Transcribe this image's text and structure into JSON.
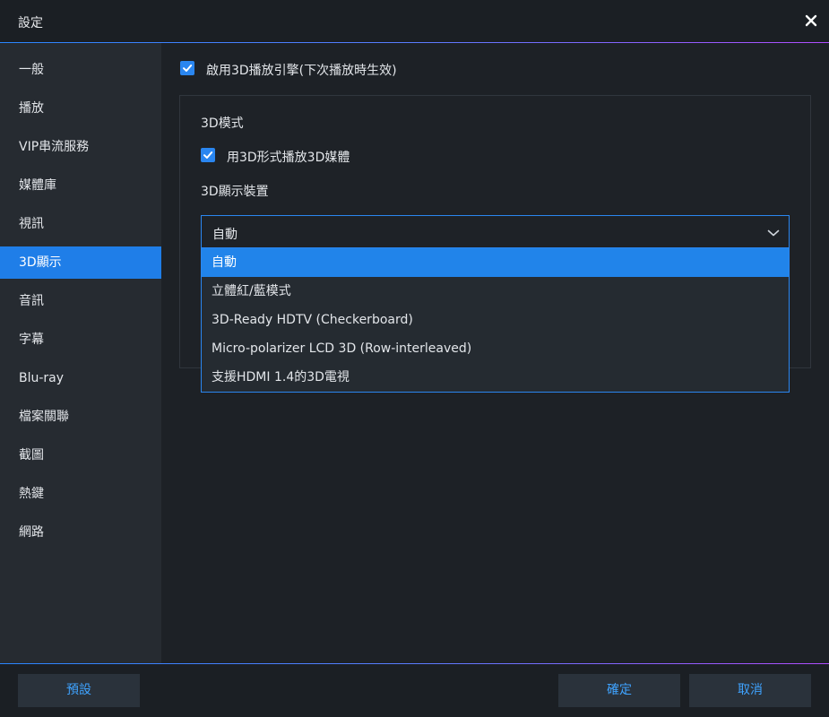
{
  "window": {
    "title": "設定",
    "close_icon": "close-icon"
  },
  "colors": {
    "accent": "#1f7ee8",
    "checkbox": "#2a86f0",
    "button_text": "#3fa3ff",
    "gradient_end": "#b14dff"
  },
  "sidebar": {
    "items": [
      {
        "label": "一般"
      },
      {
        "label": "播放"
      },
      {
        "label": "VIP串流服務"
      },
      {
        "label": "媒體庫"
      },
      {
        "label": "視訊"
      },
      {
        "label": "3D顯示",
        "active": true
      },
      {
        "label": "音訊"
      },
      {
        "label": "字幕"
      },
      {
        "label": "Blu-ray"
      },
      {
        "label": "檔案關聯"
      },
      {
        "label": "截圖"
      },
      {
        "label": "熱鍵"
      },
      {
        "label": "網路"
      }
    ]
  },
  "main": {
    "enable_3d": {
      "label": "啟用3D播放引擎(下次播放時生效)",
      "checked": true
    },
    "mode_group": {
      "heading": "3D模式",
      "play_3d": {
        "label": "用3D形式播放3D媒體",
        "checked": true
      },
      "device_heading": "3D顯示裝置",
      "device_select": {
        "value": "自動",
        "icon": "chevron-down-icon",
        "options": [
          "自動",
          "立體紅/藍模式",
          "3D-Ready HDTV (Checkerboard)",
          "Micro-polarizer LCD 3D (Row-interleaved)",
          "支援HDMI 1.4的3D電視"
        ]
      }
    }
  },
  "footer": {
    "default_label": "預設",
    "ok_label": "確定",
    "cancel_label": "取消"
  }
}
